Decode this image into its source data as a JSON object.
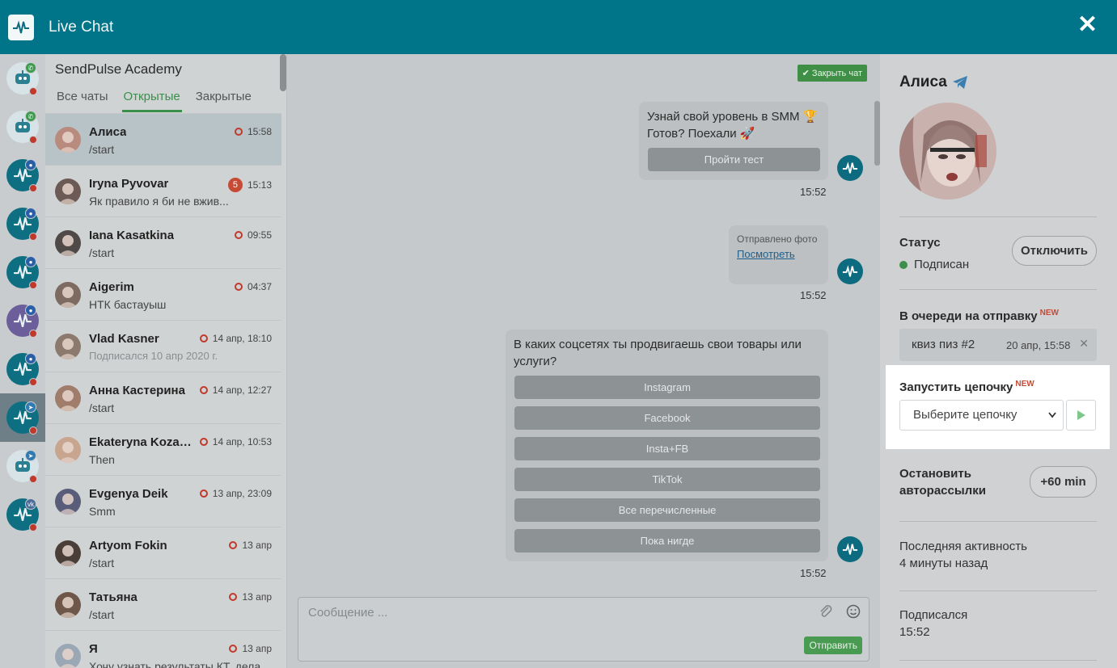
{
  "app": {
    "title": "Live Chat"
  },
  "chat_list": {
    "title": "SendPulse Academy",
    "tabs": [
      {
        "label": "Все чаты",
        "active": false
      },
      {
        "label": "Открытые",
        "active": true
      },
      {
        "label": "Закрытые",
        "active": false
      }
    ],
    "rows": [
      {
        "name": "Алиса",
        "subtitle": "/start",
        "time": "15:58",
        "unread": "",
        "active": true
      },
      {
        "name": "Iryna Pyvovar",
        "subtitle": "Як правило я би не вжив...",
        "time": "15:13",
        "unread": "5",
        "active": false
      },
      {
        "name": "Iana Kasatkina",
        "subtitle": "/start",
        "time": "09:55",
        "unread": "",
        "active": false
      },
      {
        "name": "Aigerim",
        "subtitle": "НТК бастауыш",
        "time": "04:37",
        "unread": "",
        "active": false
      },
      {
        "name": "Vlad Kasner",
        "subtitle": "Подписался 10 апр 2020 г.",
        "time": "14 апр, 18:10",
        "unread": "",
        "active": false,
        "muted": true
      },
      {
        "name": "Анна Кастерина",
        "subtitle": "/start",
        "time": "14 апр, 12:27",
        "unread": "",
        "active": false
      },
      {
        "name": "Ekateryna Kozach...",
        "subtitle": "Then",
        "time": "14 апр, 10:53",
        "unread": "",
        "active": false
      },
      {
        "name": "Evgenya Deik",
        "subtitle": "Smm",
        "time": "13 апр, 23:09",
        "unread": "",
        "active": false
      },
      {
        "name": "Artyom Fokin",
        "subtitle": "/start",
        "time": "13 апр",
        "unread": "",
        "active": false
      },
      {
        "name": "Татьяна",
        "subtitle": "/start",
        "time": "13 апр",
        "unread": "",
        "active": false
      },
      {
        "name": "Я",
        "subtitle": "Хочу узнать результаты КТ, дела...",
        "time": "13 апр",
        "unread": "",
        "active": false
      }
    ]
  },
  "rail": [
    {
      "type": "bot",
      "badge": "wa",
      "icon": "whatsapp-icon"
    },
    {
      "type": "bot",
      "badge": "wa",
      "icon": "whatsapp-icon"
    },
    {
      "type": "pulse",
      "badge": "fb",
      "icon": "messenger-icon"
    },
    {
      "type": "pulse",
      "badge": "fb",
      "icon": "messenger-icon"
    },
    {
      "type": "pulse",
      "badge": "fb",
      "icon": "messenger-icon"
    },
    {
      "type": "purple",
      "badge": "fb",
      "icon": "messenger-icon"
    },
    {
      "type": "pulse",
      "badge": "fb",
      "icon": "messenger-icon"
    },
    {
      "type": "pulse",
      "badge": "tg",
      "icon": "telegram-icon",
      "active": true
    },
    {
      "type": "bot",
      "badge": "tg",
      "icon": "telegram-icon"
    },
    {
      "type": "pulse",
      "badge": "vk",
      "icon": "vk-icon"
    }
  ],
  "conversation": {
    "close_chat_label": "Закрыть чат",
    "messages": [
      {
        "line1": "Узнай свой уровень в SMM 🏆",
        "line2": "Готов? Поехали 🚀",
        "button": "Пройти тест",
        "time": "15:52"
      },
      {
        "caption": "Отправлено фото",
        "link": "Посмотреть",
        "time": "15:52"
      },
      {
        "text": "В каких соцсетях ты продвигаешь свои товары или услуги?",
        "options": [
          "Instagram",
          "Facebook",
          "Insta+FB",
          "TikTok",
          "Все перечисленные",
          "Пока нигде"
        ],
        "time": "15:52"
      }
    ],
    "composer": {
      "placeholder": "Сообщение ...",
      "send_label": "Отправить"
    }
  },
  "profile": {
    "name": "Алиса",
    "status_label": "Статус",
    "status_value": "Подписан",
    "unsubscribe_label": "Отключить",
    "queue_label": "В очереди на отправку",
    "new_tag": "NEW",
    "queue_item": {
      "name": "квиз пиз #2",
      "time": "20 апр, 15:58"
    },
    "chain_label": "Запустить цепочку",
    "chain_select": "Выберите цепочку",
    "stop_label_1": "Остановить",
    "stop_label_2": "авторассылки",
    "stop_button": "+60 min",
    "last_activity_label": "Последняя активность",
    "last_activity_value": "4 минуты назад",
    "subscribed_label": "Подписался",
    "subscribed_value": "15:52"
  },
  "colors": {
    "header": "#007488",
    "accent_green": "#3a8f4a",
    "alert_red": "#c0392b"
  }
}
